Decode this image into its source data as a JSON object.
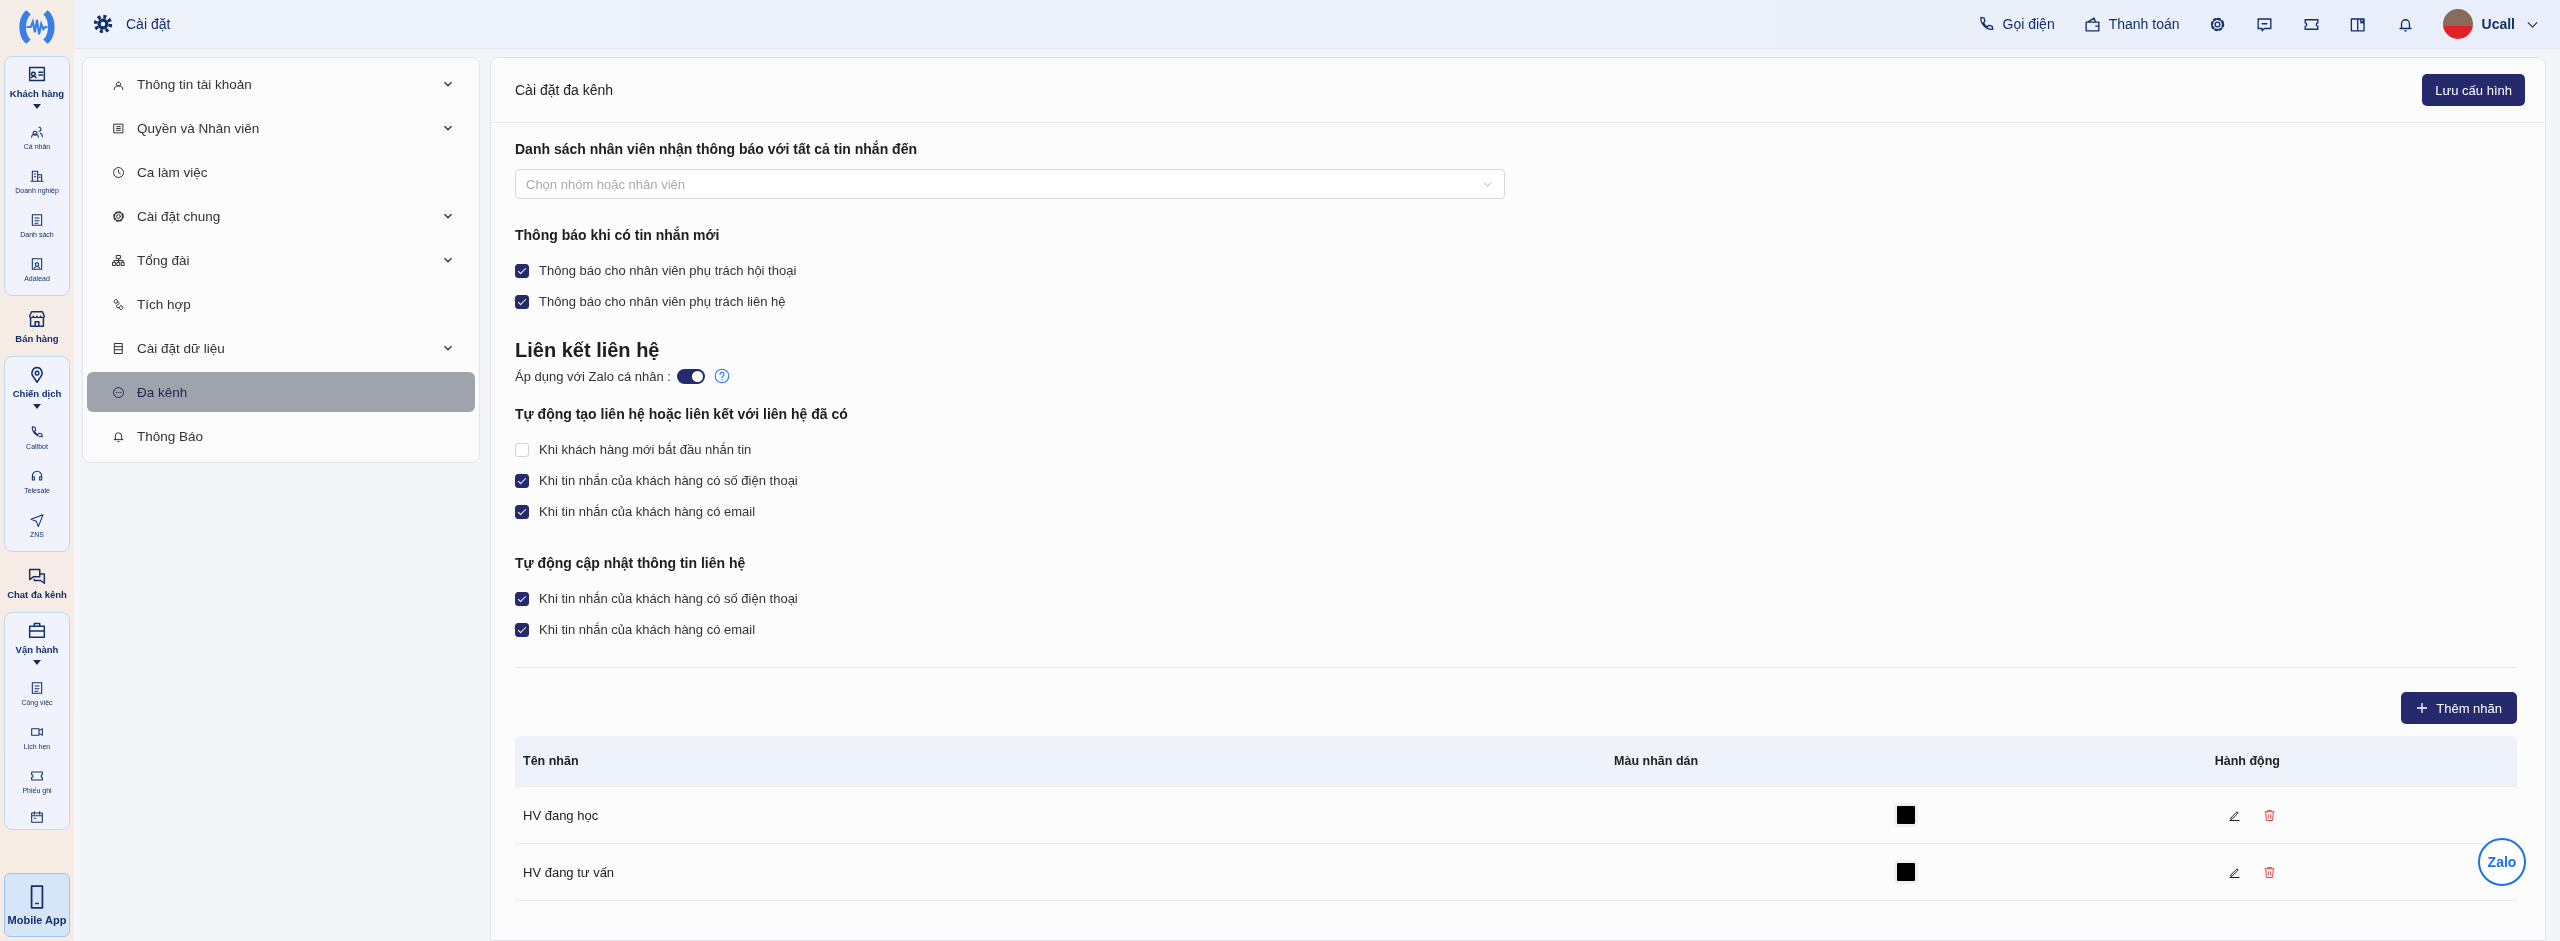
{
  "rail": {
    "sections": [
      {
        "kind": "group",
        "label": "Khách hàng",
        "expanded": true,
        "items": [
          "Cá nhân",
          "Doanh nghiệp",
          "Danh sách",
          "Adalead"
        ]
      },
      {
        "kind": "single",
        "label": "Bán hàng"
      },
      {
        "kind": "group",
        "label": "Chiến dịch",
        "expanded": true,
        "items": [
          "Callbot",
          "Telesale",
          "ZNS"
        ]
      },
      {
        "kind": "single",
        "label": "Chat đa kênh"
      },
      {
        "kind": "group",
        "label": "Vận hành",
        "expanded": true,
        "items": [
          "Công việc",
          "Lịch hẹn",
          "Phiếu ghi"
        ]
      }
    ],
    "mobile_app": "Mobile App"
  },
  "topbar": {
    "title": "Cài đặt",
    "actions": [
      "Gọi điện",
      "Thanh toán"
    ],
    "user": "Ucall"
  },
  "settings_nav": [
    {
      "label": "Thông tin tài khoản",
      "has_submenu": true,
      "selected": false
    },
    {
      "label": "Quyền và Nhân viên",
      "has_submenu": true,
      "selected": false
    },
    {
      "label": "Ca làm việc",
      "has_submenu": false,
      "selected": false
    },
    {
      "label": "Cài đặt chung",
      "has_submenu": true,
      "selected": false
    },
    {
      "label": "Tổng đài",
      "has_submenu": true,
      "selected": false
    },
    {
      "label": "Tích hợp",
      "has_submenu": false,
      "selected": false
    },
    {
      "label": "Cài đặt dữ liệu",
      "has_submenu": true,
      "selected": false
    },
    {
      "label": "Đa kênh",
      "has_submenu": false,
      "selected": true
    },
    {
      "label": "Thông Báo",
      "has_submenu": false,
      "selected": false
    }
  ],
  "panel": {
    "title": "Cài đặt đa kênh",
    "save_button": "Lưu cấu hình",
    "sections": [
      {
        "kind": "select",
        "title": "Danh sách nhân viên nhận thông báo với tất cả tin nhắn đến",
        "placeholder": "Chọn nhóm hoặc nhân viên"
      },
      {
        "kind": "checks",
        "title": "Thông báo khi có tin nhắn mới",
        "options": [
          {
            "label": "Thông báo cho nhân viên phụ trách hội thoại",
            "checked": true
          },
          {
            "label": "Thông báo cho nhân viên phụ trách liên hệ",
            "checked": true
          }
        ]
      },
      {
        "kind": "heading",
        "title": "Liên kết liên hệ"
      },
      {
        "kind": "toggle",
        "label": "Áp dụng với Zalo cá nhân :",
        "on": true
      },
      {
        "kind": "checks",
        "title": "Tự động tạo liên hệ hoặc liên kết với liên hệ đã có",
        "options": [
          {
            "label": "Khi khách hàng mới bắt đầu nhắn tin",
            "checked": false
          },
          {
            "label": "Khi tin nhắn của khách hàng có số điện thoại",
            "checked": true
          },
          {
            "label": "Khi tin nhắn của khách hàng có email",
            "checked": true
          }
        ]
      },
      {
        "kind": "checks",
        "title": "Tự động cập nhật thông tin liên hệ",
        "options": [
          {
            "label": "Khi tin nhắn của khách hàng có số điện thoại",
            "checked": true
          },
          {
            "label": "Khi tin nhắn của khách hàng có email",
            "checked": true
          }
        ]
      }
    ],
    "add_button": "Thêm nhãn",
    "table": {
      "columns": [
        "Tên nhãn",
        "Màu nhãn dán",
        "Hành động"
      ],
      "rows": [
        {
          "name": "HV đang học",
          "color": "#000000"
        },
        {
          "name": "HV đang tư vấn",
          "color": "#000000"
        }
      ]
    }
  },
  "chat_widget": "Zalo"
}
